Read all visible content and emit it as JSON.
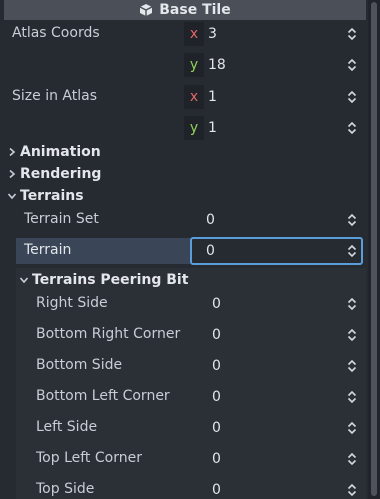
{
  "header": {
    "title": "Base Tile",
    "icon": "cube-icon"
  },
  "atlas_coords": {
    "label": "Atlas Coords",
    "x_axis": "x",
    "x_value": "3",
    "y_axis": "y",
    "y_value": "18"
  },
  "size_in_atlas": {
    "label": "Size in Atlas",
    "x_axis": "x",
    "x_value": "1",
    "y_axis": "y",
    "y_value": "1"
  },
  "sections": {
    "animation": "Animation",
    "rendering": "Rendering",
    "terrains": "Terrains"
  },
  "terrains": {
    "terrain_set_label": "Terrain Set",
    "terrain_set_value": "0",
    "terrain_label": "Terrain",
    "terrain_value": "0",
    "peering_title": "Terrains Peering Bit",
    "peering_rows": [
      {
        "label": "Right Side",
        "value": "0"
      },
      {
        "label": "Bottom Right Corner",
        "value": "0"
      },
      {
        "label": "Bottom Side",
        "value": "0"
      },
      {
        "label": "Bottom Left Corner",
        "value": "0"
      },
      {
        "label": "Left Side",
        "value": "0"
      },
      {
        "label": "Top Left Corner",
        "value": "0"
      },
      {
        "label": "Top Side",
        "value": "0"
      }
    ]
  },
  "colors": {
    "background": "#262a31",
    "header": "#4a4f58",
    "accent": "#5a9ddb",
    "axis_x": "#e06767",
    "axis_y": "#8fd158"
  }
}
